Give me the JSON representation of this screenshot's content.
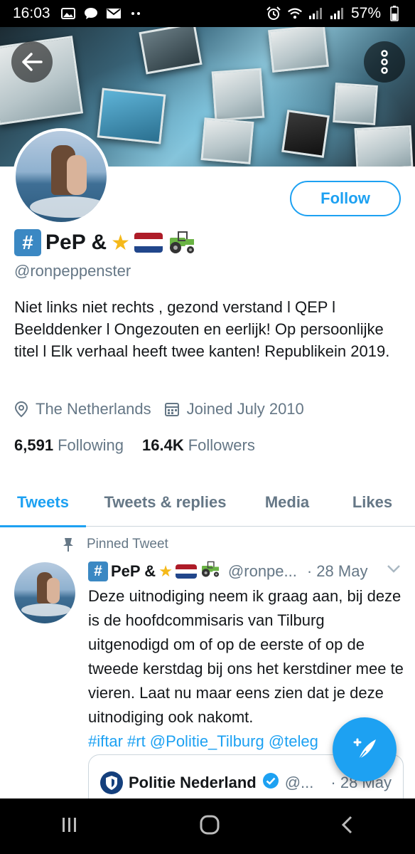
{
  "status_bar": {
    "time": "16:03",
    "battery": "57%"
  },
  "profile": {
    "display_name": "PeP &",
    "hash_badge": "#",
    "handle": "@ronpeppenster",
    "follow_label": "Follow",
    "bio": "Niet links niet rechts , gezond verstand l QEP l Beelddenker l Ongezouten en eerlijk! Op persoonlijke titel l Elk verhaal heeft twee kanten! Republikein 2019.",
    "location": "The Netherlands",
    "joined": "Joined July 2010",
    "following_count": "6,591",
    "following_label": "Following",
    "followers_count": "16.4K",
    "followers_label": "Followers"
  },
  "tabs": [
    {
      "label": "Tweets",
      "active": true
    },
    {
      "label": "Tweets & replies",
      "active": false
    },
    {
      "label": "Media",
      "active": false
    },
    {
      "label": "Likes",
      "active": false
    }
  ],
  "pinned_tweet": {
    "pinned_label": "Pinned Tweet",
    "name": "PeP &",
    "handle": "@ronpe...",
    "date": "· 28 May",
    "text": "Deze uitnodiging neem ik graag aan, bij deze is de hoofdcommisaris van Tilburg uitgenodigd om of  op de eerste of op de tweede kerstdag bij ons het kerstdiner mee te vieren. Laat nu maar eens zien dat je deze uitnodiging ook nakomt.",
    "tags": "#iftar #rt @Politie_Tilburg @teleg"
  },
  "quoted_tweet": {
    "name": "Politie Nederland",
    "handle": "@...",
    "date": "· 28 May"
  },
  "colors": {
    "accent": "#1da1f2",
    "secondary_text": "#657786",
    "hash_badge": "#3b88c3"
  }
}
